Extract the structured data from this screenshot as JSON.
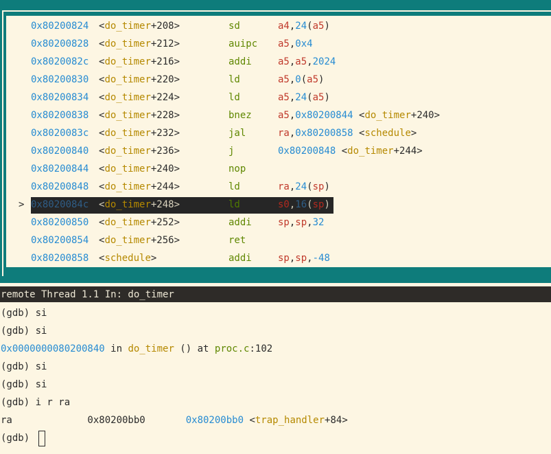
{
  "asm": {
    "rows": [
      {
        "addr": "0x80200824",
        "fn": "do_timer",
        "off": "+208",
        "mnemonic": "sd",
        "ops": [
          {
            "t": "a4",
            "k": "reg"
          },
          {
            "t": ",",
            "k": "p"
          },
          {
            "t": "24",
            "k": "num"
          },
          {
            "t": "(",
            "k": "p"
          },
          {
            "t": "a5",
            "k": "reg"
          },
          {
            "t": ")",
            "k": "p"
          }
        ]
      },
      {
        "addr": "0x80200828",
        "fn": "do_timer",
        "off": "+212",
        "mnemonic": "auipc",
        "ops": [
          {
            "t": "a5",
            "k": "reg"
          },
          {
            "t": ",",
            "k": "p"
          },
          {
            "t": "0x4",
            "k": "num"
          }
        ]
      },
      {
        "addr": "0x8020082c",
        "fn": "do_timer",
        "off": "+216",
        "mnemonic": "addi",
        "ops": [
          {
            "t": "a5",
            "k": "reg"
          },
          {
            "t": ",",
            "k": "p"
          },
          {
            "t": "a5",
            "k": "reg"
          },
          {
            "t": ",",
            "k": "p"
          },
          {
            "t": "2024",
            "k": "num"
          }
        ]
      },
      {
        "addr": "0x80200830",
        "fn": "do_timer",
        "off": "+220",
        "mnemonic": "ld",
        "ops": [
          {
            "t": "a5",
            "k": "reg"
          },
          {
            "t": ",",
            "k": "p"
          },
          {
            "t": "0",
            "k": "num"
          },
          {
            "t": "(",
            "k": "p"
          },
          {
            "t": "a5",
            "k": "reg"
          },
          {
            "t": ")",
            "k": "p"
          }
        ]
      },
      {
        "addr": "0x80200834",
        "fn": "do_timer",
        "off": "+224",
        "mnemonic": "ld",
        "ops": [
          {
            "t": "a5",
            "k": "reg"
          },
          {
            "t": ",",
            "k": "p"
          },
          {
            "t": "24",
            "k": "num"
          },
          {
            "t": "(",
            "k": "p"
          },
          {
            "t": "a5",
            "k": "reg"
          },
          {
            "t": ")",
            "k": "p"
          }
        ]
      },
      {
        "addr": "0x80200838",
        "fn": "do_timer",
        "off": "+228",
        "mnemonic": "bnez",
        "ops": [
          {
            "t": "a5",
            "k": "reg"
          },
          {
            "t": ",",
            "k": "p"
          },
          {
            "t": "0x80200844",
            "k": "num"
          },
          {
            "t": " <",
            "k": "p"
          },
          {
            "t": "do_timer",
            "k": "fn"
          },
          {
            "t": "+240>",
            "k": "p"
          }
        ]
      },
      {
        "addr": "0x8020083c",
        "fn": "do_timer",
        "off": "+232",
        "mnemonic": "jal",
        "ops": [
          {
            "t": "ra",
            "k": "reg"
          },
          {
            "t": ",",
            "k": "p"
          },
          {
            "t": "0x80200858",
            "k": "num"
          },
          {
            "t": " <",
            "k": "p"
          },
          {
            "t": "schedule",
            "k": "fn"
          },
          {
            "t": ">",
            "k": "p"
          }
        ]
      },
      {
        "addr": "0x80200840",
        "fn": "do_timer",
        "off": "+236",
        "mnemonic": "j",
        "ops": [
          {
            "t": "0x80200848",
            "k": "num"
          },
          {
            "t": " <",
            "k": "p"
          },
          {
            "t": "do_timer",
            "k": "fn"
          },
          {
            "t": "+244>",
            "k": "p"
          }
        ]
      },
      {
        "addr": "0x80200844",
        "fn": "do_timer",
        "off": "+240",
        "mnemonic": "nop",
        "ops": []
      },
      {
        "addr": "0x80200848",
        "fn": "do_timer",
        "off": "+244",
        "mnemonic": "ld",
        "ops": [
          {
            "t": "ra",
            "k": "reg"
          },
          {
            "t": ",",
            "k": "p"
          },
          {
            "t": "24",
            "k": "num"
          },
          {
            "t": "(",
            "k": "p"
          },
          {
            "t": "sp",
            "k": "reg"
          },
          {
            "t": ")",
            "k": "p"
          }
        ]
      },
      {
        "addr": "0x8020084c",
        "fn": "do_timer",
        "off": "+248",
        "mnemonic": "ld",
        "current": true,
        "marker": ">",
        "ops": [
          {
            "t": "s0",
            "k": "reg"
          },
          {
            "t": ",",
            "k": "p"
          },
          {
            "t": "16",
            "k": "num"
          },
          {
            "t": "(",
            "k": "p"
          },
          {
            "t": "sp",
            "k": "reg"
          },
          {
            "t": ")",
            "k": "p"
          }
        ]
      },
      {
        "addr": "0x80200850",
        "fn": "do_timer",
        "off": "+252",
        "mnemonic": "addi",
        "ops": [
          {
            "t": "sp",
            "k": "reg"
          },
          {
            "t": ",",
            "k": "p"
          },
          {
            "t": "sp",
            "k": "reg"
          },
          {
            "t": ",",
            "k": "p"
          },
          {
            "t": "32",
            "k": "num"
          }
        ]
      },
      {
        "addr": "0x80200854",
        "fn": "do_timer",
        "off": "+256",
        "mnemonic": "ret",
        "ops": []
      },
      {
        "addr": "0x80200858",
        "fn": "schedule",
        "off": "",
        "mnemonic": "addi",
        "ops": [
          {
            "t": "sp",
            "k": "reg"
          },
          {
            "t": ",",
            "k": "p"
          },
          {
            "t": "sp",
            "k": "reg"
          },
          {
            "t": ",",
            "k": "p"
          },
          {
            "t": "-48",
            "k": "num"
          }
        ]
      }
    ]
  },
  "status": {
    "text": "remote Thread 1.1 In: do_timer"
  },
  "console": {
    "lines": [
      [
        {
          "t": "(gdb) si",
          "k": "p"
        }
      ],
      [
        {
          "t": "(gdb) si",
          "k": "p"
        }
      ],
      [
        {
          "t": "0x0000000080200840",
          "k": "num"
        },
        {
          "t": " in ",
          "k": "p"
        },
        {
          "t": "do_timer",
          "k": "fn"
        },
        {
          "t": " () at ",
          "k": "p"
        },
        {
          "t": "proc.c",
          "k": "file"
        },
        {
          "t": ":102",
          "k": "p"
        }
      ],
      [
        {
          "t": "(gdb) si",
          "k": "p"
        }
      ],
      [
        {
          "t": "(gdb) si",
          "k": "p"
        }
      ],
      [
        {
          "t": "(gdb) i r ra",
          "k": "p"
        }
      ],
      [
        {
          "t": "ra             0x80200bb0       ",
          "k": "p"
        },
        {
          "t": "0x80200bb0",
          "k": "num"
        },
        {
          "t": " <",
          "k": "p"
        },
        {
          "t": "trap_handler",
          "k": "fn"
        },
        {
          "t": "+84>",
          "k": "p"
        }
      ],
      [
        {
          "t": "(gdb) ",
          "k": "p"
        }
      ]
    ],
    "prompt_has_cursor": true
  },
  "colors": {
    "background": "#fdf6e3",
    "frame": "#0e7c7b",
    "address": "#268bd2",
    "function": "#b58900",
    "mnemonic": "#5f8700",
    "register": "#c0392b",
    "file": "#5f8700"
  }
}
